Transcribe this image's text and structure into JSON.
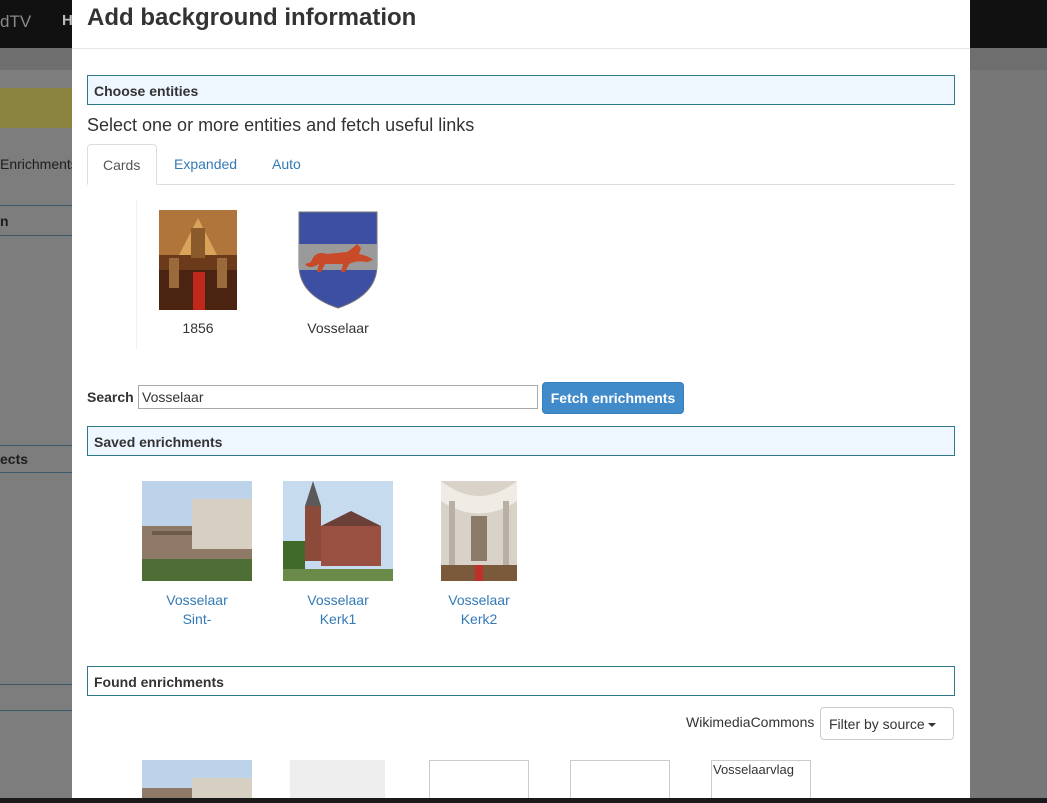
{
  "background_app": {
    "brand": "dTV",
    "nav_item": "H",
    "sidebar_text_1": "Enrichments",
    "sidebar_text_2": "n",
    "sidebar_text_3": "ects"
  },
  "modal": {
    "title": "Add background information",
    "choose_section": {
      "title": "Choose entities"
    },
    "subtitle": "Select one or more entities and fetch useful links",
    "tabs": [
      {
        "label": "Cards",
        "active": true
      },
      {
        "label": "Expanded",
        "active": false
      },
      {
        "label": "Auto",
        "active": false
      }
    ],
    "cards": [
      {
        "label": "1856"
      },
      {
        "label": "Vosselaar"
      }
    ],
    "search": {
      "label": "Search",
      "value": "Vosselaar",
      "fetch_button": "Fetch enrichments"
    },
    "saved_section": {
      "title": "Saved enrichments"
    },
    "saved_enrichments": [
      {
        "line1": "Vosselaar",
        "line2": "Sint-"
      },
      {
        "line1": "Vosselaar",
        "line2": "Kerk1"
      },
      {
        "line1": "Vosselaar",
        "line2": "Kerk2"
      }
    ],
    "found_section": {
      "title": "Found enrichments"
    },
    "source_label": "WikimediaCommons",
    "filter_button": "Filter by source",
    "found_items": [
      {
        "label": ""
      },
      {
        "label": ""
      },
      {
        "label": ""
      },
      {
        "label": ""
      },
      {
        "label": "Vosselaarvlag"
      }
    ]
  },
  "colors": {
    "link": "#337ab7",
    "primary_button": "#428bca",
    "section_border": "#2f7a86",
    "section_bg": "#eef6ff"
  }
}
